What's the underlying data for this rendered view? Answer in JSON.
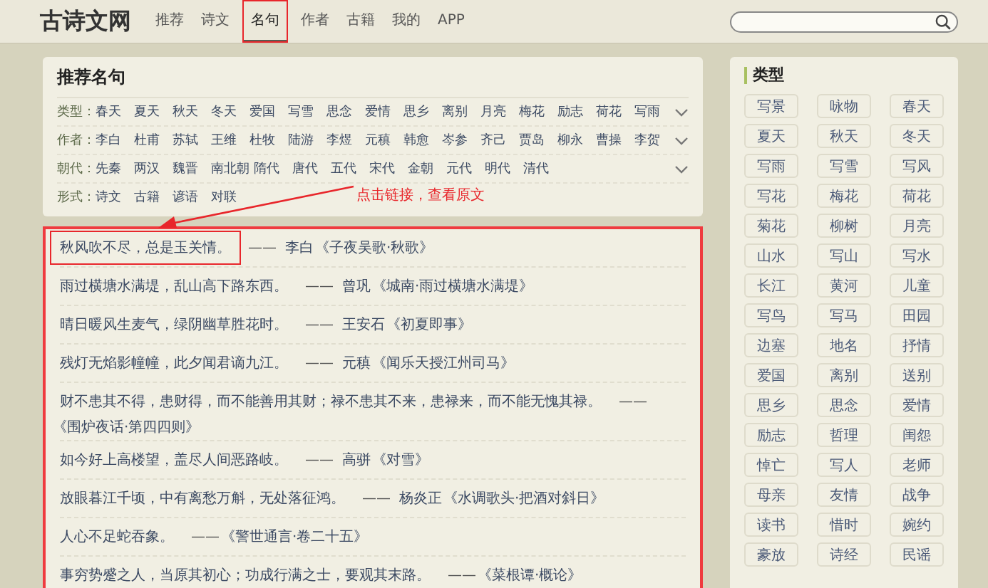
{
  "site": {
    "logo": "古诗文网"
  },
  "nav": [
    {
      "label": "推荐",
      "selected": false,
      "highlighted": false
    },
    {
      "label": "诗文",
      "selected": false,
      "highlighted": false
    },
    {
      "label": "名句",
      "selected": true,
      "highlighted": true
    },
    {
      "label": "作者",
      "selected": false,
      "highlighted": false
    },
    {
      "label": "古籍",
      "selected": false,
      "highlighted": false
    },
    {
      "label": "我的",
      "selected": false,
      "highlighted": false
    },
    {
      "label": "APP",
      "selected": false,
      "highlighted": false
    }
  ],
  "filters": {
    "title": "推荐名句",
    "rows": [
      {
        "label": "类型：",
        "expandable": true,
        "items": [
          "春天",
          "夏天",
          "秋天",
          "冬天",
          "爱国",
          "写雪",
          "思念",
          "爱情",
          "思乡",
          "离别",
          "月亮",
          "梅花",
          "励志",
          "荷花",
          "写雨"
        ]
      },
      {
        "label": "作者：",
        "expandable": true,
        "items": [
          "李白",
          "杜甫",
          "苏轼",
          "王维",
          "杜牧",
          "陆游",
          "李煜",
          "元稹",
          "韩愈",
          "岑参",
          "齐己",
          "贾岛",
          "柳永",
          "曹操",
          "李贺"
        ]
      },
      {
        "label": "朝代：",
        "expandable": true,
        "items": [
          "先秦",
          "两汉",
          "魏晋",
          "南北朝",
          "隋代",
          "唐代",
          "五代",
          "宋代",
          "金朝",
          "元代",
          "明代",
          "清代"
        ]
      },
      {
        "label": "形式：",
        "expandable": false,
        "items": [
          "诗文",
          "古籍",
          "谚语",
          "对联"
        ]
      }
    ]
  },
  "annotation": {
    "text": "点击链接，查看原文"
  },
  "quotes": [
    {
      "text": "秋风吹不尽，总是玉关情。",
      "dash": "——",
      "author": "李白",
      "source": "《子夜吴歌·秋歌》",
      "highlighted": true
    },
    {
      "text": "雨过横塘水满堤，乱山高下路东西。",
      "dash": "——",
      "author": "曾巩",
      "source": "《城南·雨过横塘水满堤》",
      "highlighted": false
    },
    {
      "text": "晴日暖风生麦气，绿阴幽草胜花时。",
      "dash": "——",
      "author": "王安石",
      "source": "《初夏即事》",
      "highlighted": false
    },
    {
      "text": "残灯无焰影幢幢，此夕闻君谪九江。",
      "dash": "——",
      "author": "元稹",
      "source": "《闻乐天授江州司马》",
      "highlighted": false
    },
    {
      "text": "财不患其不得，患财得，而不能善用其财；禄不患其不来，患禄来，而不能无愧其禄。",
      "dash": "——",
      "source": "《围炉夜话·第四四则》",
      "highlighted": false
    },
    {
      "text": "如今好上高楼望，盖尽人间恶路岐。",
      "dash": "——",
      "author": "高骈",
      "source": "《对雪》",
      "highlighted": false
    },
    {
      "text": "放眼暮江千顷，中有离愁万斛，无处落征鸿。",
      "dash": "——",
      "author": "杨炎正",
      "source": "《水调歌头·把酒对斜日》",
      "highlighted": false
    },
    {
      "text": "人心不足蛇吞象。",
      "dash": "——",
      "source": "《警世通言·卷二十五》",
      "highlighted": false
    },
    {
      "text": "事穷势蹙之人，当原其初心；功成行满之士，要观其末路。",
      "dash": "——",
      "source": "《菜根谭·概论》",
      "highlighted": false
    }
  ],
  "sidebar": {
    "title": "类型",
    "tags": [
      "写景",
      "咏物",
      "春天",
      "夏天",
      "秋天",
      "冬天",
      "写雨",
      "写雪",
      "写风",
      "写花",
      "梅花",
      "荷花",
      "菊花",
      "柳树",
      "月亮",
      "山水",
      "写山",
      "写水",
      "长江",
      "黄河",
      "儿童",
      "写鸟",
      "写马",
      "田园",
      "边塞",
      "地名",
      "抒情",
      "爱国",
      "离别",
      "送别",
      "思乡",
      "思念",
      "爱情",
      "励志",
      "哲理",
      "闺怨",
      "悼亡",
      "写人",
      "老师",
      "母亲",
      "友情",
      "战争",
      "读书",
      "惜时",
      "婉约",
      "豪放",
      "诗经",
      "民谣"
    ]
  }
}
